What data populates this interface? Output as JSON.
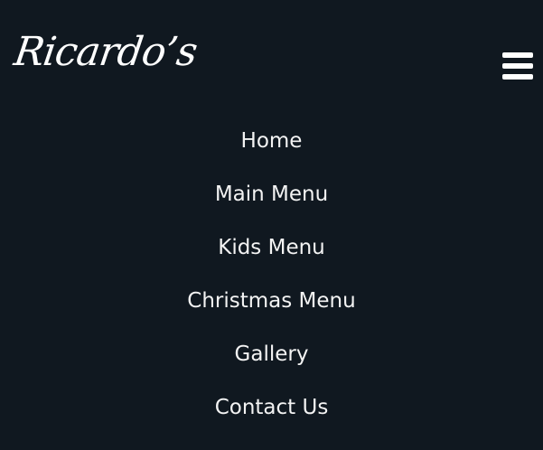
{
  "header": {
    "brand": "Ricardo’s",
    "menu_icon": "hamburger-menu-icon"
  },
  "nav": {
    "items": [
      {
        "label": "Home"
      },
      {
        "label": "Main Menu"
      },
      {
        "label": "Kids Menu"
      },
      {
        "label": "Christmas Menu"
      },
      {
        "label": "Gallery"
      },
      {
        "label": "Contact Us"
      }
    ]
  },
  "colors": {
    "background": "#101820",
    "text": "#f3f3f3"
  }
}
